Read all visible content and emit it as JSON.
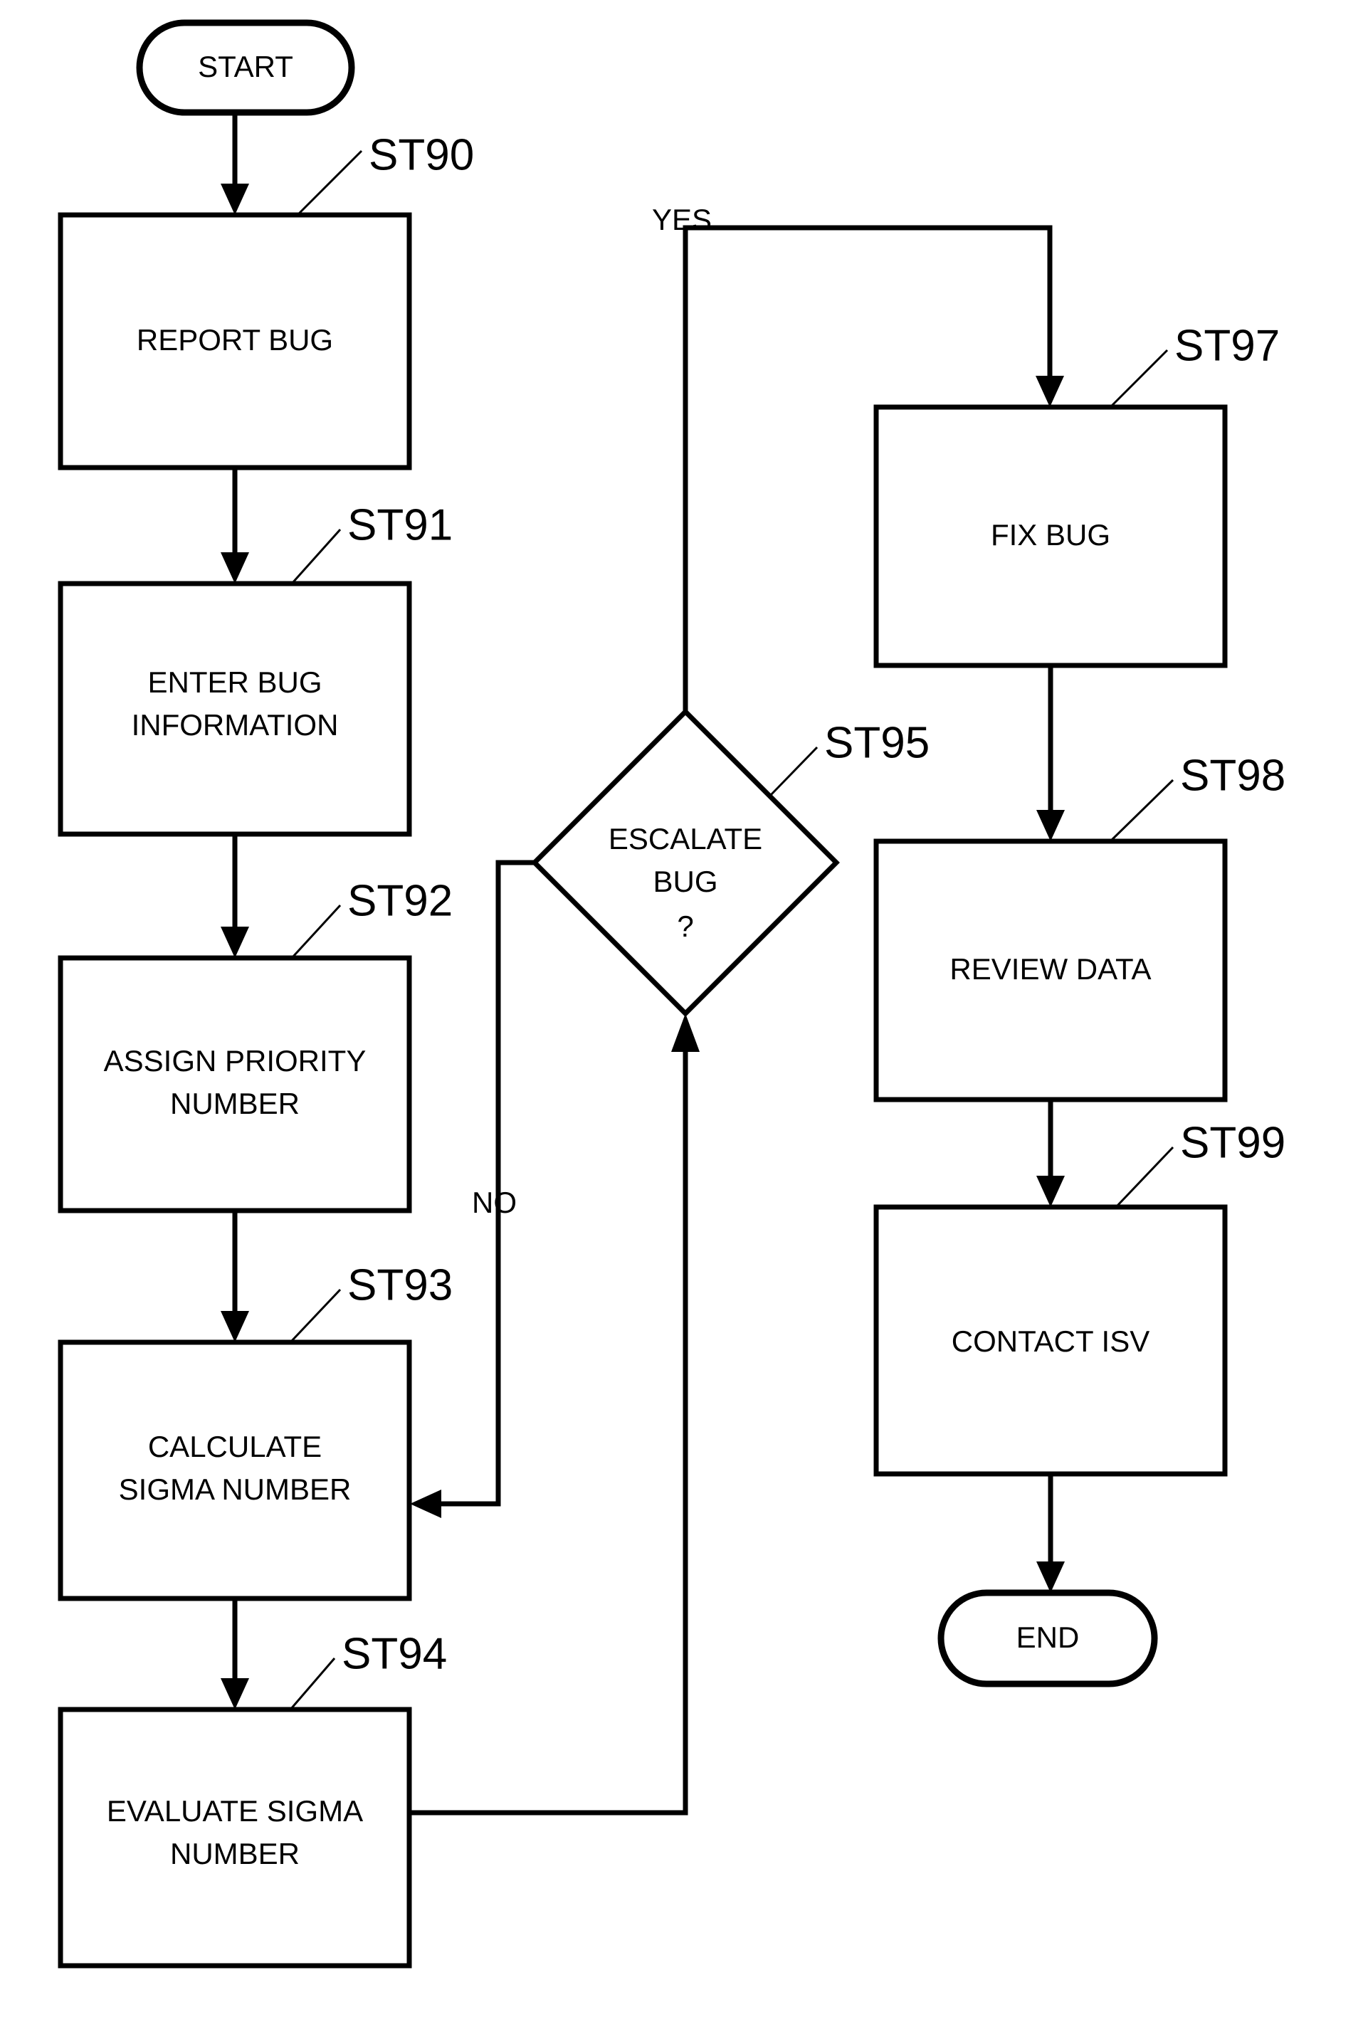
{
  "diagram": {
    "type": "flowchart",
    "title": "Bug reporting and escalation process flowchart",
    "terminals": {
      "start": "START",
      "end": "END"
    },
    "nodes": [
      {
        "id": "st90",
        "ref": "ST90",
        "label": "REPORT BUG",
        "shape": "process"
      },
      {
        "id": "st91",
        "ref": "ST91",
        "label_line1": "ENTER BUG",
        "label_line2": "INFORMATION",
        "shape": "process"
      },
      {
        "id": "st92",
        "ref": "ST92",
        "label_line1": "ASSIGN PRIORITY",
        "label_line2": "NUMBER",
        "shape": "process"
      },
      {
        "id": "st93",
        "ref": "ST93",
        "label_line1": "CALCULATE",
        "label_line2": "SIGMA NUMBER",
        "shape": "process"
      },
      {
        "id": "st94",
        "ref": "ST94",
        "label_line1": "EVALUATE SIGMA",
        "label_line2": "NUMBER",
        "shape": "process"
      },
      {
        "id": "st95",
        "ref": "ST95",
        "label_line1": "ESCALATE",
        "label_line2": "BUG",
        "label_line3": "?",
        "shape": "decision"
      },
      {
        "id": "st97",
        "ref": "ST97",
        "label": "FIX BUG",
        "shape": "process"
      },
      {
        "id": "st98",
        "ref": "ST98",
        "label": "REVIEW DATA",
        "shape": "process"
      },
      {
        "id": "st99",
        "ref": "ST99",
        "label": "CONTACT ISV",
        "shape": "process"
      }
    ],
    "branch_labels": {
      "yes": "YES",
      "no": "NO"
    },
    "colors": {
      "stroke": "#000000",
      "background": "#ffffff"
    }
  }
}
